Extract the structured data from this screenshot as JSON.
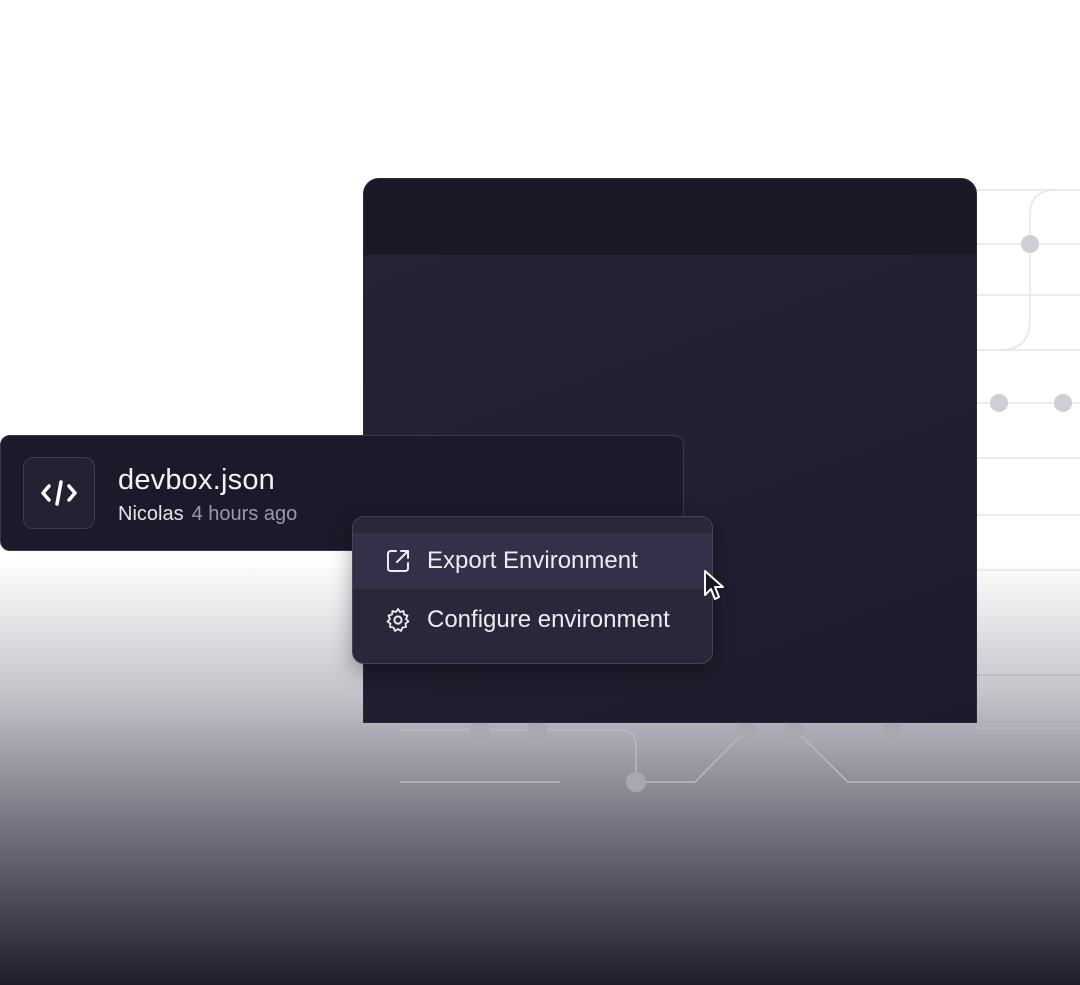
{
  "file": {
    "name": "devbox.json",
    "author": "Nicolas",
    "time": "4 hours ago",
    "icon": "code-icon"
  },
  "menu": {
    "items": [
      {
        "label": "Export Environment",
        "icon": "external-link-icon",
        "hovered": true
      },
      {
        "label": "Configure environment",
        "icon": "gear-icon",
        "hovered": false
      }
    ]
  },
  "colors": {
    "window_bg": "#211f30",
    "card_bg": "#1c1a2a",
    "menu_bg": "#29273a",
    "text": "#f2f1f6",
    "muted": "#9b99a8"
  }
}
